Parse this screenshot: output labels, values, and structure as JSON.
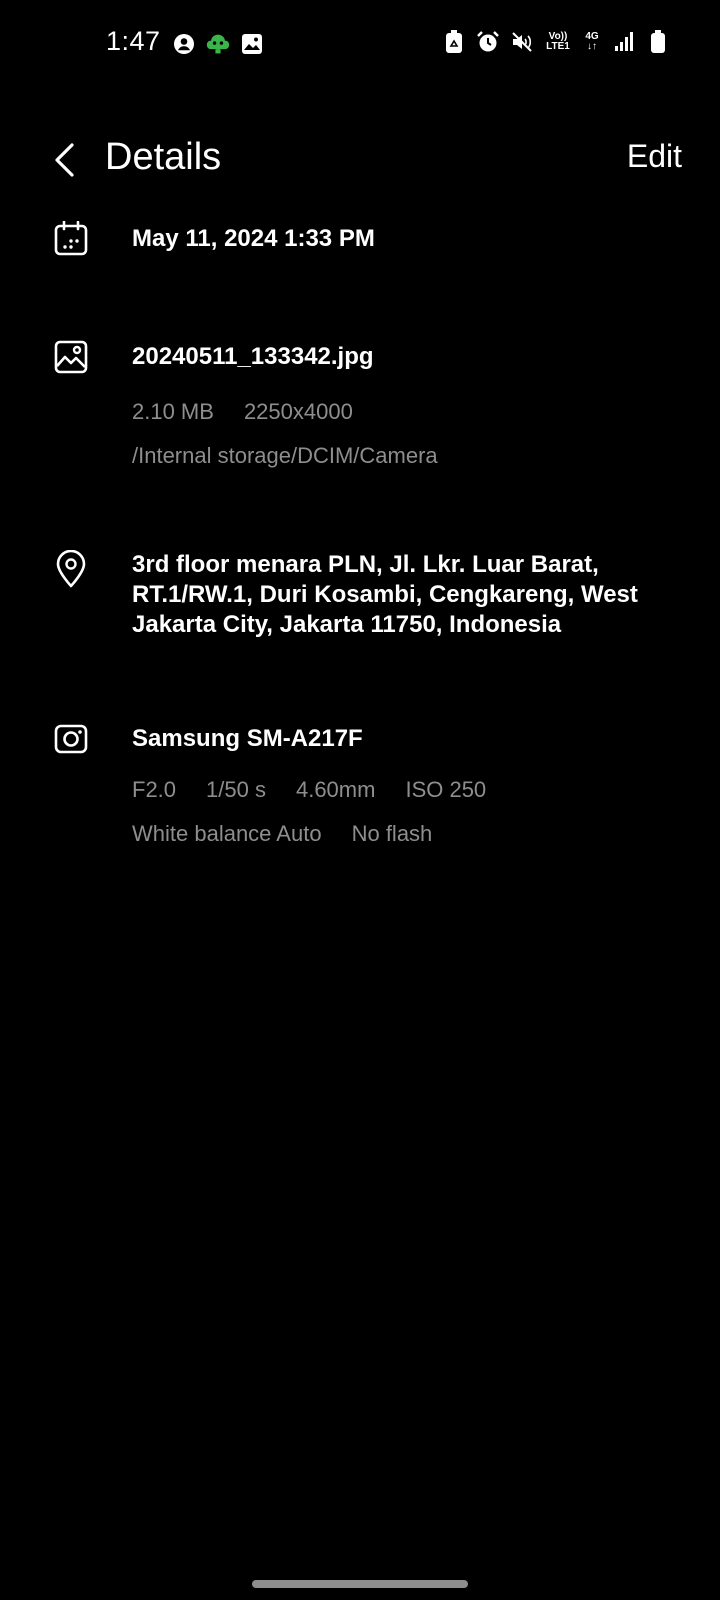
{
  "status_bar": {
    "time": "1:47",
    "left_icons": [
      "account-icon",
      "app-notification-icon",
      "gallery-icon"
    ],
    "right_icons": [
      "battery-saver-icon",
      "alarm-icon",
      "mute-icon",
      "volte-icon",
      "4g-icon",
      "signal-icon",
      "battery-icon"
    ],
    "volte_label_top": "Vo))",
    "volte_label_bottom": "LTE1",
    "network_label": "4G"
  },
  "header": {
    "title": "Details",
    "edit_label": "Edit"
  },
  "details": {
    "date": {
      "icon": "calendar-icon",
      "value": "May 11, 2024 1:33 PM"
    },
    "file": {
      "icon": "image-icon",
      "name": "20240511_133342.jpg",
      "size": "2.10 MB",
      "resolution": "2250x4000",
      "path": "/Internal storage/DCIM/Camera"
    },
    "location": {
      "icon": "location-pin-icon",
      "address": "3rd floor menara PLN, Jl. Lkr. Luar Barat, RT.1/RW.1, Duri Kosambi, Cengkareng, West Jakarta City, Jakarta 11750, Indonesia"
    },
    "camera": {
      "icon": "camera-icon",
      "model": "Samsung SM-A217F",
      "aperture": "F2.0",
      "shutter": "1/50 s",
      "focal_length": "4.60mm",
      "iso": "ISO 250",
      "white_balance": "White balance Auto",
      "flash": "No flash"
    }
  },
  "colors": {
    "background": "#000000",
    "primary_text": "#ffffff",
    "secondary_text": "#8e8e8e",
    "app_icon_green": "#3bb54a"
  }
}
